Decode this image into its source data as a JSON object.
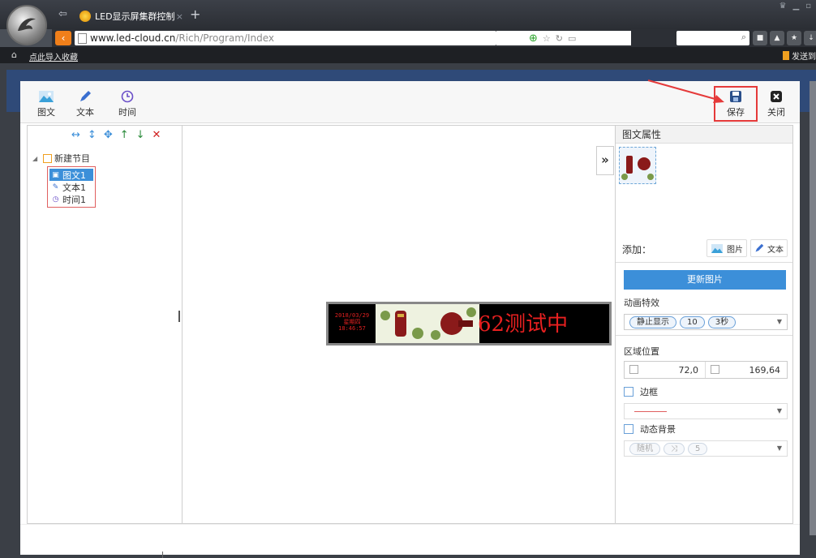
{
  "browser": {
    "tab_title": "LED显示屏集群控制",
    "tab_close": "×",
    "new_tab": "+",
    "url_host": "www.led-cloud.cn",
    "url_path": "/Rich/Program/Index",
    "fav_link": "点此导入收藏",
    "fav_right": "发送到"
  },
  "toolbar": {
    "image_text_label": "图文",
    "text_label": "文本",
    "time_label": "时间",
    "save_label": "保存",
    "close_label": "关闭"
  },
  "tree": {
    "root_label": "新建节目",
    "items": [
      {
        "label": "图文1",
        "icon": "image-icon",
        "selected": true
      },
      {
        "label": "文本1",
        "icon": "pencil-icon",
        "selected": false
      },
      {
        "label": "时间1",
        "icon": "clock-icon",
        "selected": false
      }
    ]
  },
  "led": {
    "date": "2018/03/29",
    "weekday": "星期四",
    "time": "18:46:57",
    "scroll_text": "62测试中"
  },
  "properties": {
    "title": "图文属性",
    "add_label": "添加：",
    "add_image": "图片",
    "add_text": "文本",
    "update_button": "更新图片",
    "animation_label": "动画特效",
    "animation_effect": "静止显示",
    "animation_speed": "10",
    "animation_duration": "3秒",
    "region_label": "区域位置",
    "position_value": "72,0",
    "size_value": "169,64",
    "border_label": "边框",
    "dynamic_bg_label": "动态背景",
    "dyn_mode": "随机",
    "dyn_value": "5"
  },
  "colors": {
    "accent": "#3c8fd9",
    "highlight_frame": "#e53a3a",
    "led_text": "#e82020"
  }
}
